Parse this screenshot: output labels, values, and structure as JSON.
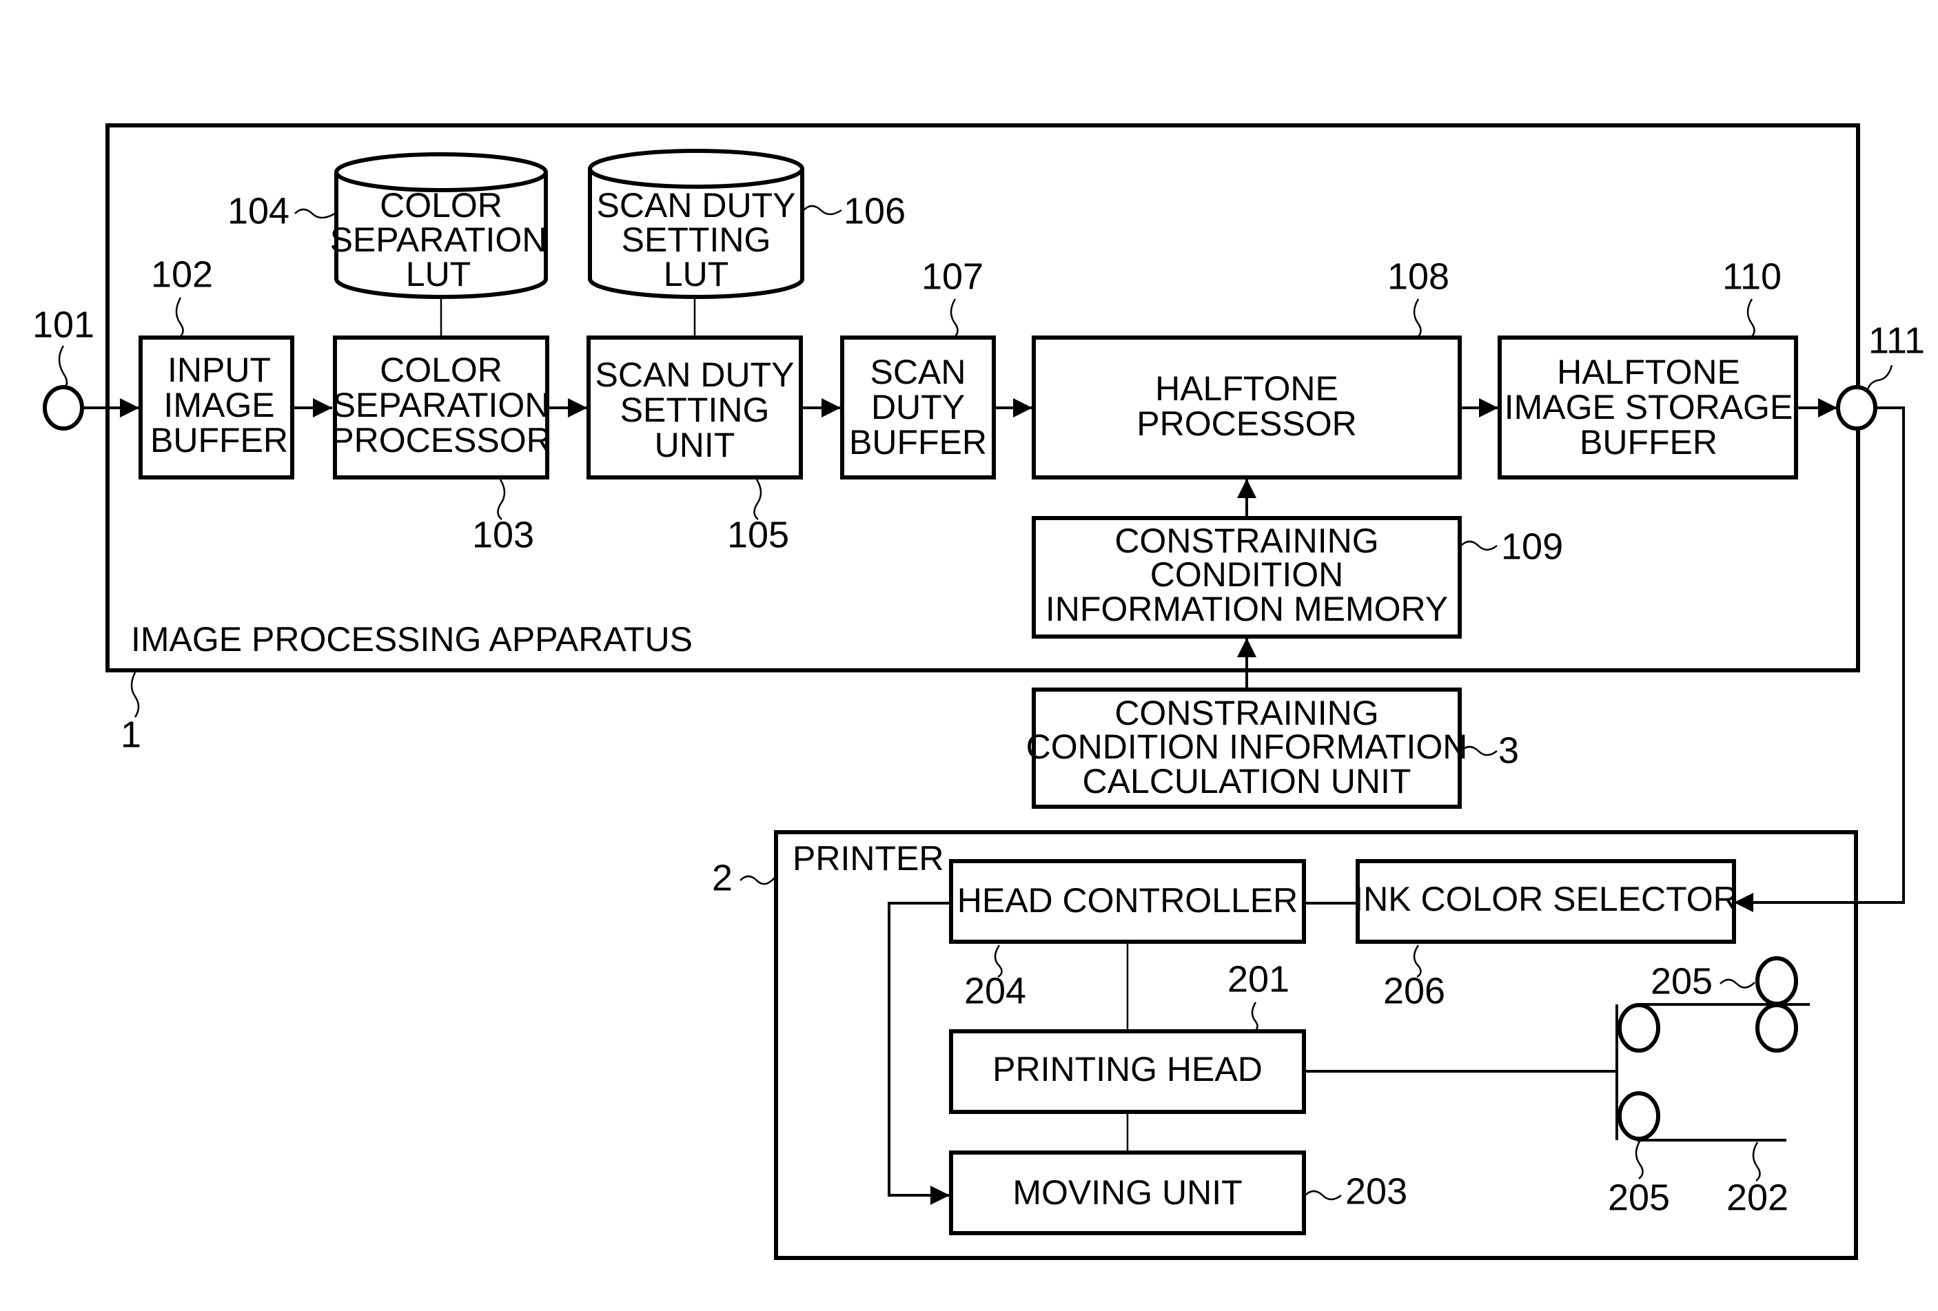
{
  "containers": {
    "apparatus": {
      "label": "IMAGE PROCESSING APPARATUS",
      "ref": "1"
    },
    "printer": {
      "label": "PRINTER",
      "ref": "2"
    }
  },
  "terminals": {
    "input": {
      "ref": "101"
    },
    "output": {
      "ref": "111"
    }
  },
  "blocks": {
    "b102": {
      "ref": "102",
      "lines": [
        "INPUT",
        "IMAGE",
        "BUFFER"
      ]
    },
    "b103": {
      "ref": "103",
      "lines": [
        "COLOR",
        "SEPARATION",
        "PROCESSOR"
      ]
    },
    "b104": {
      "ref": "104",
      "lines": [
        "COLOR",
        "SEPARATION",
        "LUT"
      ]
    },
    "b105": {
      "ref": "105",
      "lines": [
        "SCAN DUTY",
        "SETTING",
        "UNIT"
      ]
    },
    "b106": {
      "ref": "106",
      "lines": [
        "SCAN DUTY",
        "SETTING",
        "LUT"
      ]
    },
    "b107": {
      "ref": "107",
      "lines": [
        "SCAN",
        "DUTY",
        "BUFFER"
      ]
    },
    "b108": {
      "ref": "108",
      "lines": [
        "HALFTONE",
        "PROCESSOR"
      ]
    },
    "b109": {
      "ref": "109",
      "lines": [
        "CONSTRAINING",
        "CONDITION",
        "INFORMATION MEMORY"
      ]
    },
    "b110": {
      "ref": "110",
      "lines": [
        "HALFTONE",
        "IMAGE STORAGE",
        "BUFFER"
      ]
    },
    "b3": {
      "ref": "3",
      "lines": [
        "CONSTRAINING",
        "CONDITION INFORMATION",
        "CALCULATION UNIT"
      ]
    },
    "b204": {
      "ref": "204",
      "lines": [
        "HEAD CONTROLLER"
      ]
    },
    "b206": {
      "ref": "206",
      "lines": [
        "INK COLOR SELECTOR"
      ]
    },
    "b201": {
      "ref": "201",
      "lines": [
        "PRINTING HEAD"
      ]
    },
    "b203": {
      "ref": "203",
      "lines": [
        "MOVING UNIT"
      ]
    }
  },
  "rollers": {
    "ref_top": "205",
    "ref_bottom": "205",
    "paper_ref": "202"
  }
}
